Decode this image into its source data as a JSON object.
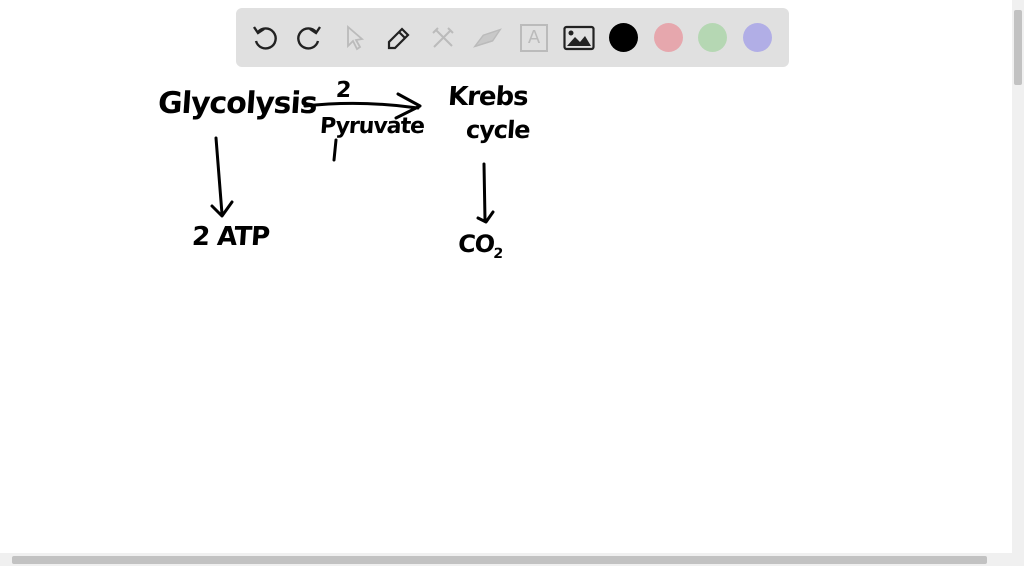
{
  "toolbar": {
    "tools": [
      "undo-icon",
      "redo-icon",
      "select-icon",
      "pen-icon",
      "tools-icon",
      "eraser-icon",
      "text-icon",
      "image-icon"
    ],
    "colors": [
      "#000000",
      "#e6a7ad",
      "#b5d7b3",
      "#b1aee6"
    ],
    "text_tool_glyph": "A"
  },
  "board": {
    "glycolysis": "Glycolysis",
    "arrow_top_label": "2",
    "arrow_bottom_label": "Pyruvate",
    "krebs_line1": "Krebs",
    "krebs_line2": "cycle",
    "atp": "2 ATP",
    "co2": "CO",
    "co2_sub": "2"
  }
}
